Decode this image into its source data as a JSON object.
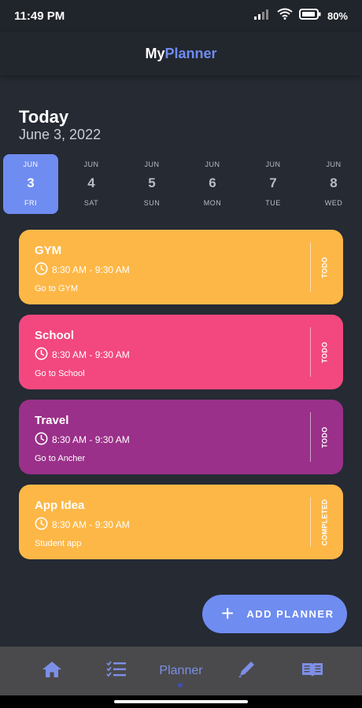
{
  "status_bar": {
    "time": "11:49 PM",
    "battery": "80%",
    "icons": [
      "signal-icon",
      "wifi-icon",
      "battery-icon"
    ]
  },
  "header": {
    "brand_my": "My",
    "brand_planner": "Planner"
  },
  "today": {
    "title": "Today",
    "date": "June 3, 2022"
  },
  "date_strip": [
    {
      "month": "JUN",
      "day": "3",
      "weekday": "FRI",
      "selected": true
    },
    {
      "month": "JUN",
      "day": "4",
      "weekday": "SAT",
      "selected": false
    },
    {
      "month": "JUN",
      "day": "5",
      "weekday": "SUN",
      "selected": false
    },
    {
      "month": "JUN",
      "day": "6",
      "weekday": "MON",
      "selected": false
    },
    {
      "month": "JUN",
      "day": "7",
      "weekday": "TUE",
      "selected": false
    },
    {
      "month": "JUN",
      "day": "8",
      "weekday": "WED",
      "selected": false
    }
  ],
  "tasks": [
    {
      "title": "GYM",
      "time": "8:30 AM - 9:30 AM",
      "description": "Go to GYM",
      "status": "TODO",
      "color": "#fdb747"
    },
    {
      "title": "School",
      "time": "8:30 AM - 9:30 AM",
      "description": "Go to School",
      "status": "TODO",
      "color": "#f2487f"
    },
    {
      "title": "Travel",
      "time": "8:30 AM - 9:30 AM",
      "description": "Go to Ancher",
      "status": "TODO",
      "color": "#9a3089"
    },
    {
      "title": "App Idea",
      "time": "8:30 AM - 9:30 AM",
      "description": "Student app",
      "status": "COMPLETED",
      "color": "#fdb747"
    }
  ],
  "add_button": {
    "label": "ADD PLANNER"
  },
  "bottom_nav": {
    "items": [
      {
        "icon": "home-icon"
      },
      {
        "icon": "checklist-icon"
      },
      {
        "label": "Planner",
        "active": true
      },
      {
        "icon": "pencil-icon"
      },
      {
        "icon": "book-icon"
      }
    ]
  },
  "colors": {
    "accent": "#6f8cf0",
    "background": "#252a33",
    "nav_background": "#4a4a4c"
  }
}
